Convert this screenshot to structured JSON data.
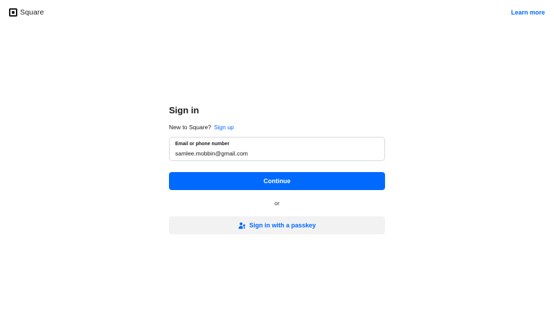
{
  "header": {
    "brand_name": "Square",
    "learn_more": "Learn more"
  },
  "signin": {
    "title": "Sign in",
    "new_prompt": "New to Square?",
    "sign_up_link": "Sign up",
    "email_label": "Email or phone number",
    "email_value": "samlee.mobbin@gmail.com",
    "continue_label": "Continue",
    "or_text": "or",
    "passkey_label": "Sign in with a passkey"
  },
  "colors": {
    "accent": "#006aff",
    "secondary_bg": "#f2f2f2",
    "border": "#d9d9d9"
  },
  "icons": {
    "brand": "square-logo-icon",
    "passkey": "person-key-icon"
  }
}
